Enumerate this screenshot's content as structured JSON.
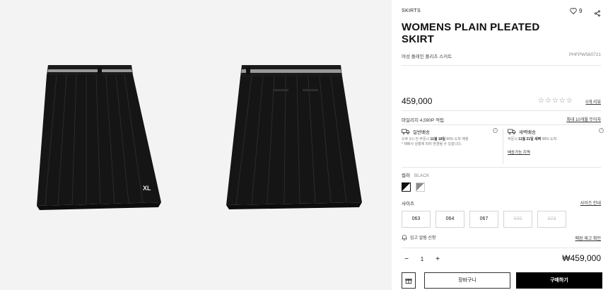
{
  "product": {
    "category": "SKIRTS",
    "wish_count": "9",
    "title": "WOMENS PLAIN PLEATED SKIRT",
    "subtitle": "여성 플레인 플리츠 스커트",
    "sku": "PHFPW560721",
    "price": "459,000",
    "reviews_link": "0개 리뷰",
    "rating": 0,
    "rating_max": 5
  },
  "benefits": {
    "mileage": "마일리지 4,590P 적립",
    "installment": "최대 10개월 무이자"
  },
  "shipping": {
    "standard": {
      "title": "일반배송",
      "line1_pre": "오후 3시 전 주문시 ",
      "line1_bold": "11월 18일",
      "line1_post": " 89% 도착 예정",
      "line2": "* 택배사 상황에 따라 변경될 수 있습니다."
    },
    "dawn": {
      "title": "새벽배송",
      "line1_pre": "주문시 ",
      "line1_bold": "11월 21일 새벽",
      "line1_post": " 98% 도착",
      "link": "배송가능 지역"
    }
  },
  "color": {
    "label": "컬러",
    "selected": "BLACK",
    "swatches": [
      "#111111",
      "#8c8c8c"
    ]
  },
  "size": {
    "label": "사이즈",
    "guide": "사이즈 안내",
    "options": [
      {
        "label": "063",
        "available": true
      },
      {
        "label": "064",
        "available": true
      },
      {
        "label": "067",
        "available": true
      },
      {
        "label": "070",
        "available": false
      },
      {
        "label": "073",
        "available": false
      }
    ]
  },
  "restock": {
    "label": "입고 알림 신청",
    "store_stock": "매장 재고 확인"
  },
  "order": {
    "quantity": "1",
    "total": "₩459,000",
    "cart_label": "장바구니",
    "buy_label": "구매하기"
  },
  "icons": {
    "wish": "heart-icon",
    "share": "share-icon",
    "gift": "gift-icon",
    "bell": "bell-icon",
    "truck": "truck-icon"
  },
  "brand": {
    "logo": "XL"
  }
}
